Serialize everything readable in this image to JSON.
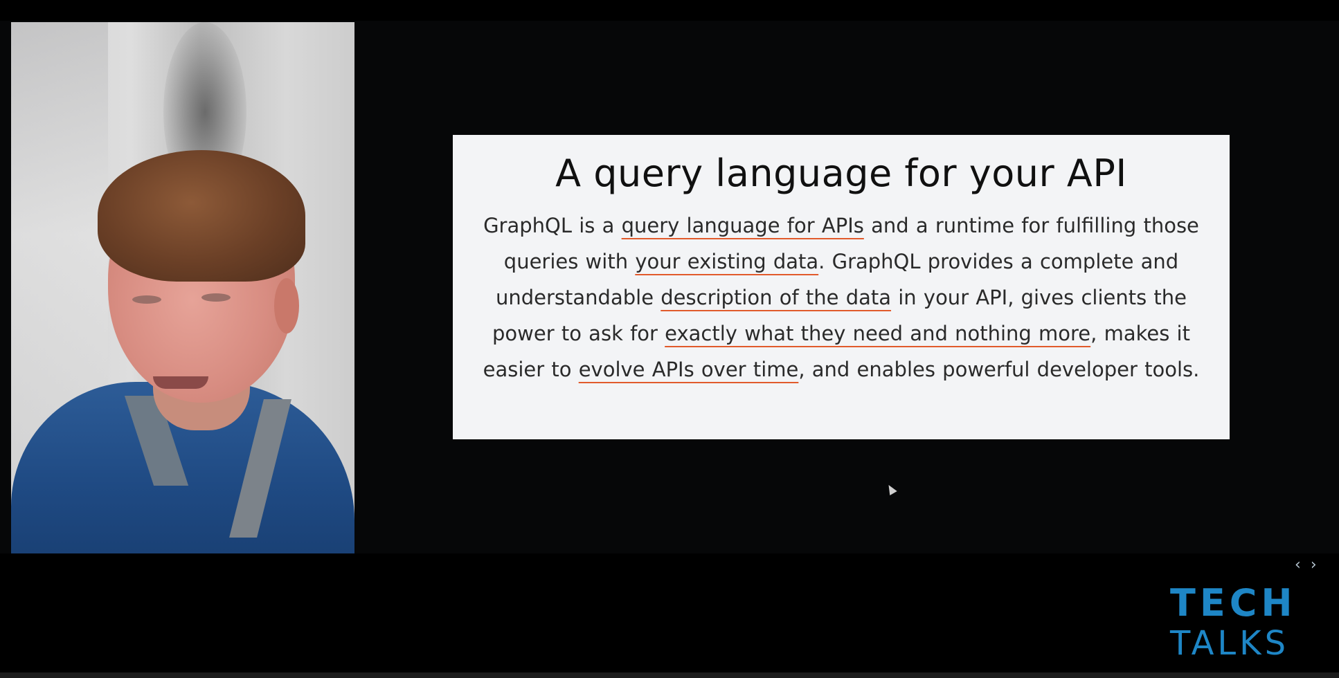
{
  "slide": {
    "title": "A query language for your API",
    "body": {
      "p1": "GraphQL is a ",
      "h1": "query language for APIs",
      "p2": " and a runtime for fulfilling those queries with ",
      "h2": "your existing data",
      "p3": ". GraphQL provides a complete and understandable ",
      "h3": "description of the data",
      "p4": " in your API, gives clients the power to ask for ",
      "h4": "exactly what they need and nothing more",
      "p5": ", makes it easier to ",
      "h5": "evolve APIs over time",
      "p6": ", and enables powerful developer tools."
    },
    "highlight_color": "#e15a2b"
  },
  "nav": {
    "prev_icon": "chevron-left-icon",
    "next_icon": "chevron-right-icon",
    "prev_glyph": "‹",
    "next_glyph": "›"
  },
  "brand": {
    "line1": "TECH",
    "line2": "TALKS",
    "color": "#1e86c6"
  }
}
